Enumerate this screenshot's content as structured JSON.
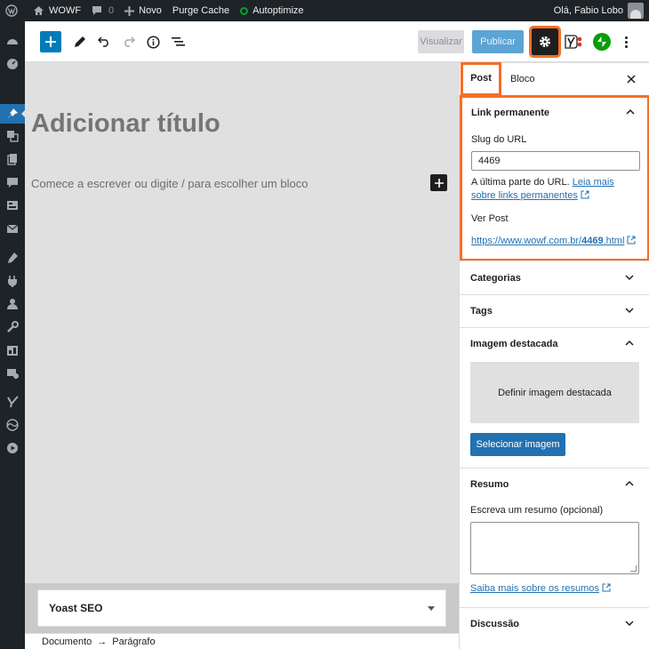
{
  "admin_bar": {
    "site_name": "WOWF",
    "comments_count": "0",
    "new_label": "Novo",
    "purge_cache_label": "Purge Cache",
    "autoptimize_label": "Autoptimize",
    "greeting": "Olá, Fabio Lobo"
  },
  "toolbar": {
    "preview_label": "Visualizar",
    "publish_label": "Publicar"
  },
  "editor": {
    "title_placeholder": "Adicionar título",
    "block_placeholder": "Comece a escrever ou digite / para escolher um bloco"
  },
  "sidebar": {
    "tabs": [
      {
        "label": "Post",
        "active": true
      },
      {
        "label": "Bloco",
        "active": false
      }
    ],
    "permalink": {
      "title": "Link permanente",
      "slug_label": "Slug do URL",
      "slug_value": "4469",
      "help_prefix": "A última parte do URL. ",
      "help_link": "Leia mais sobre links permanentes",
      "view_label": "Ver Post",
      "url_prefix": "https://www.wowf.com.br/",
      "url_slug": "4469",
      "url_suffix": ".html"
    },
    "panels": {
      "categories": "Categorias",
      "tags": "Tags",
      "featured_image": "Imagem destacada",
      "featured_image_drop": "Definir imagem destacada",
      "select_image": "Selecionar imagem",
      "excerpt": "Resumo",
      "excerpt_label": "Escreva um resumo (opcional)",
      "excerpt_link": "Saiba mais sobre os resumos",
      "discussion": "Discussão"
    }
  },
  "metabox": {
    "yoast_title": "Yoast SEO"
  },
  "footer": {
    "breadcrumb": [
      "Documento",
      "Parágrafo"
    ]
  },
  "colors": {
    "accent": "#2271b1",
    "highlight": "#f56e28",
    "admin_bar": "#1d2327"
  }
}
